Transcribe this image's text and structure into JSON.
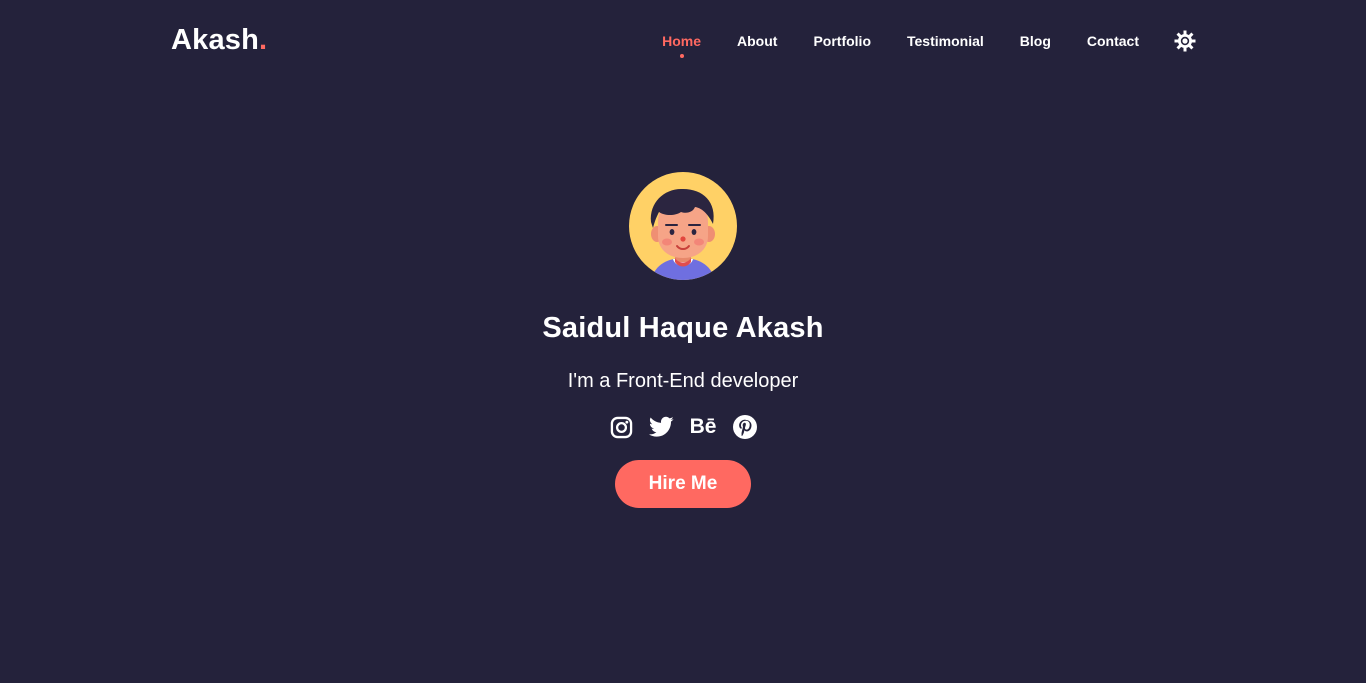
{
  "header": {
    "logo_text": "Akash",
    "logo_dot": ".",
    "nav": [
      {
        "label": "Home",
        "active": true
      },
      {
        "label": "About"
      },
      {
        "label": "Portfolio"
      },
      {
        "label": "Testimonial"
      },
      {
        "label": "Blog"
      },
      {
        "label": "Contact"
      }
    ],
    "theme_toggle_icon": "sun-gear-icon"
  },
  "hero": {
    "avatar_icon": "cartoon-avatar",
    "name": "Saidul Haque Akash",
    "tagline": "I'm a Front-End developer",
    "socials": [
      {
        "icon": "instagram-icon"
      },
      {
        "icon": "twitter-icon"
      },
      {
        "icon": "behance-icon",
        "text": "Bē"
      },
      {
        "icon": "pinterest-icon"
      }
    ],
    "cta_label": "Hire Me"
  },
  "colors": {
    "background": "#24223b",
    "accent": "#ff6961",
    "avatar_bg": "#ffd166",
    "text": "#ffffff"
  }
}
